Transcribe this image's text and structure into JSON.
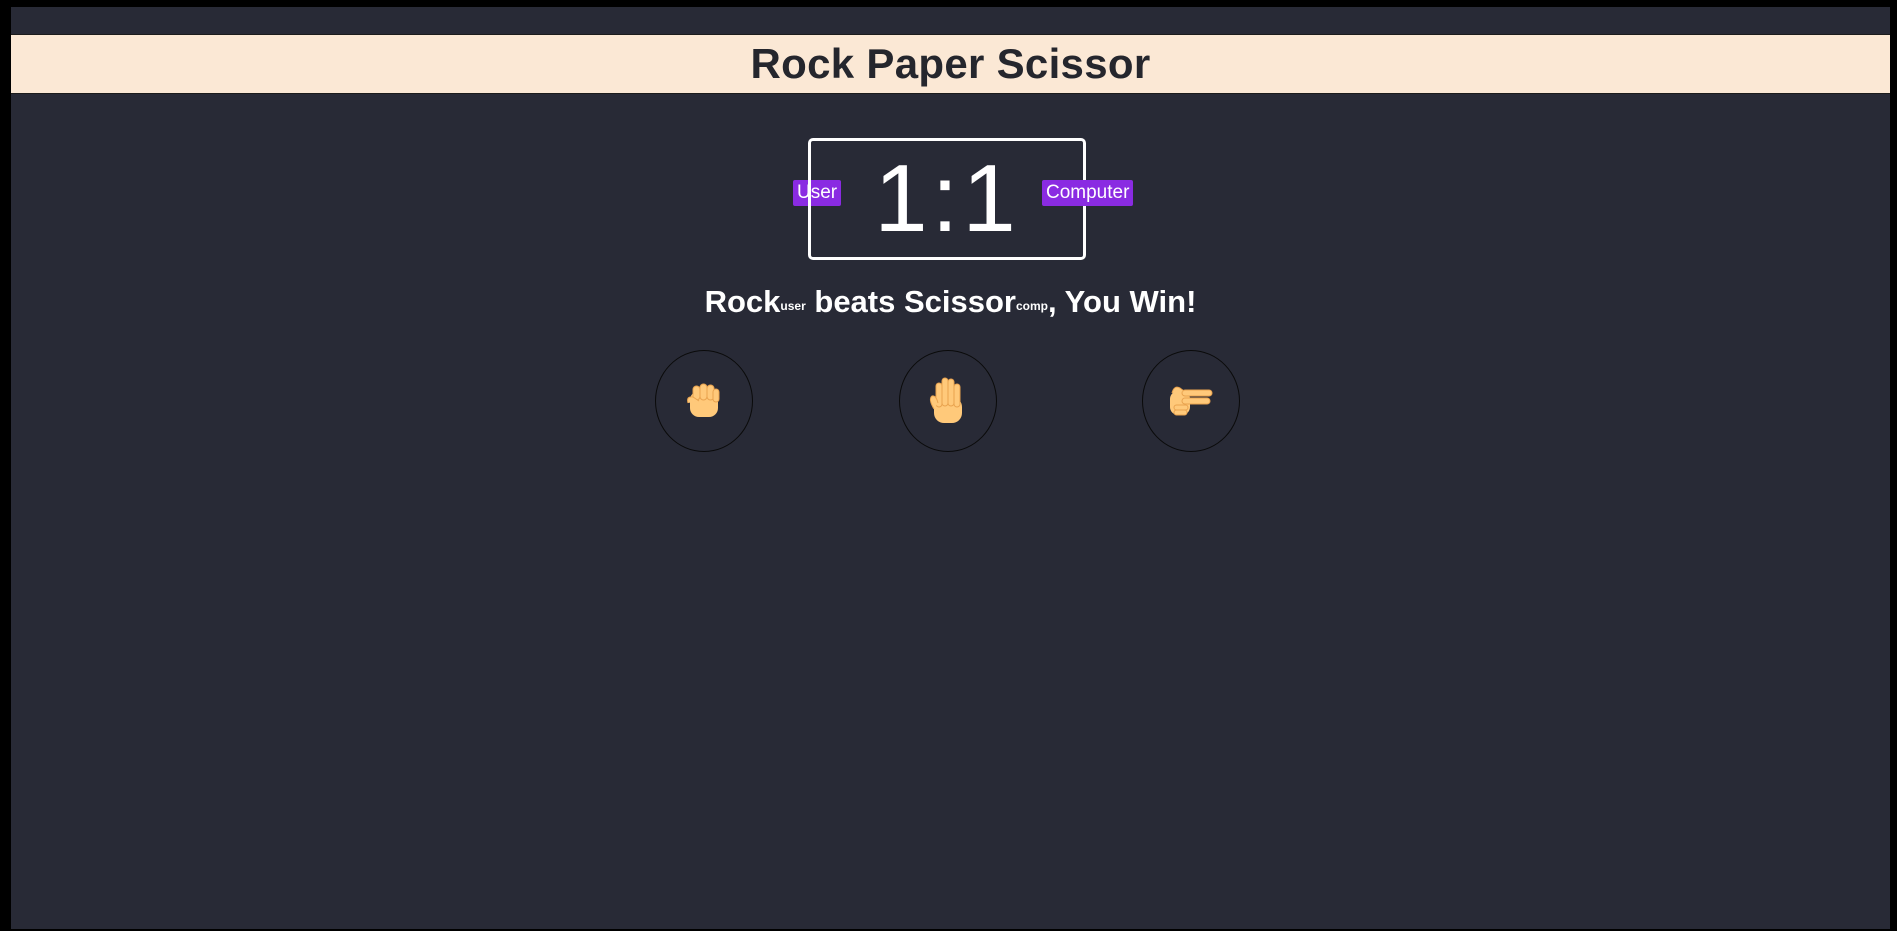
{
  "header": {
    "title": "Rock Paper Scissor"
  },
  "score": {
    "display": "1:1",
    "user_label": "User",
    "computer_label": "Computer"
  },
  "result": {
    "user_choice": "Rock",
    "user_tag": "user",
    "middle": " beats ",
    "computer_choice": "Scissor",
    "computer_tag": "comp",
    "suffix": ", You Win!"
  },
  "choices": [
    {
      "name": "rock",
      "icon": "raised-fist-icon"
    },
    {
      "name": "paper",
      "icon": "raised-hand-icon"
    },
    {
      "name": "scissor",
      "icon": "victory-hand-icon"
    }
  ],
  "colors": {
    "background": "#282a36",
    "header_bg": "#fbe8d5",
    "badge": "#8a2be2",
    "text": "#ffffff",
    "skin": "#ffc97a"
  }
}
